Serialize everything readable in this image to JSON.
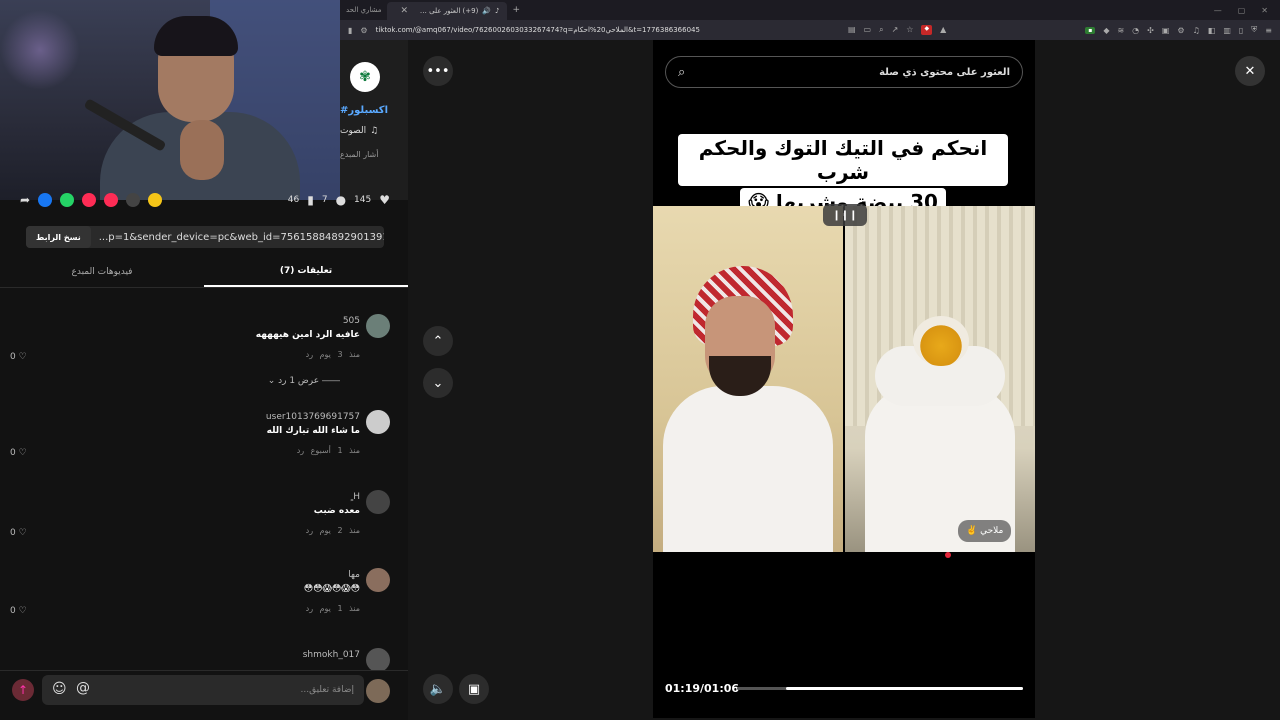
{
  "browser": {
    "prev_tab_label": "مشاري الحد",
    "active_tab_label": "(9+) العثور على \"احكام الملاحي\"",
    "url": "tiktok.com/@amq067/video/7626002603033267474?q=الملاحي20%احكام&t=1776386366045"
  },
  "creator": {
    "hashtag": "#اكسبلور",
    "sound_label": "الصوت",
    "mention_label": "أشار المبدع"
  },
  "actions": {
    "likes": "145",
    "comments": "7",
    "saves": "46"
  },
  "share": {
    "copy_label": "نسخ الرابط",
    "link_text": "...p=1&sender_device=pc&web_id=7561588489290139147"
  },
  "tabs": [
    {
      "label": "(7) تعليقات"
    },
    {
      "label": "فيديوهات المبدع"
    }
  ],
  "comments": [
    {
      "name": "505",
      "text": "عافيه الرد امين هيهههه",
      "meta": "منذ 3 يوم  رد",
      "likes": "0",
      "replies": "عرض 1 رد"
    },
    {
      "name": "user1013769691757",
      "text": "ما شاء الله تبارك الله",
      "meta": "منذ 1 أسبوع  رد",
      "likes": "0"
    },
    {
      "name": "H ٍ",
      "text": "معده ضبب",
      "meta": "منذ 2 يوم  رد",
      "likes": "0"
    },
    {
      "name": "مها",
      "text": "😳😱😳😱😳😳",
      "meta": "منذ 1 يوم  رد",
      "likes": "0"
    },
    {
      "name": "shmokh_017"
    }
  ],
  "comment_input": {
    "placeholder": "إضافة تعليق..."
  },
  "search": {
    "text": "العثور على محتوى ذي صلة"
  },
  "video": {
    "caption_line1": "انحكم في التيك التوك والحكم شرب",
    "caption_line2": "30 بيضة وشربها 😱",
    "watermark": "ملاحي ✌️",
    "timecode": "01:19/01:06",
    "progress": 0.17
  },
  "colors": {
    "accent": "#fe2c55",
    "link": "#5aa9ff"
  }
}
